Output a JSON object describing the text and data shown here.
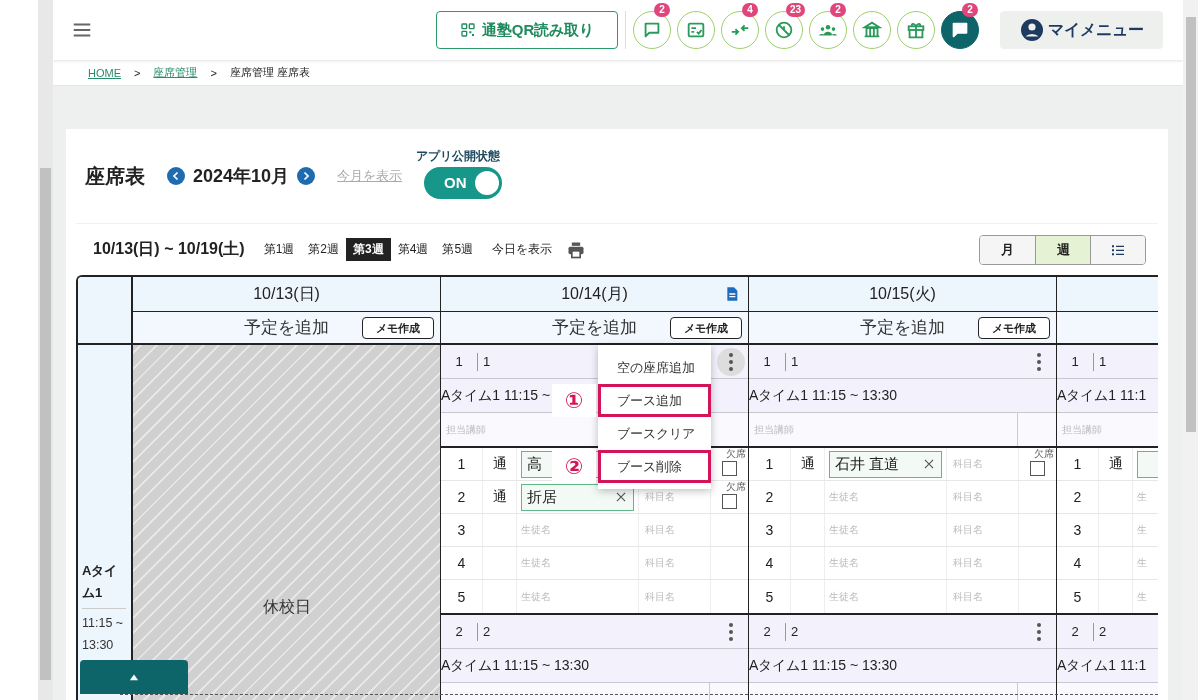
{
  "header": {
    "qr_button": "通塾QR読み取り",
    "icon_buttons": [
      {
        "kind": "chat",
        "badge": "2",
        "filled": false
      },
      {
        "kind": "checklist",
        "filled": false
      },
      {
        "kind": "arrows",
        "badge": "4",
        "filled": false
      },
      {
        "kind": "blocked",
        "badge": "23",
        "filled": false
      },
      {
        "kind": "group",
        "badge": "2",
        "filled": false
      },
      {
        "kind": "building",
        "filled": false
      },
      {
        "kind": "gift",
        "filled": false
      },
      {
        "kind": "chat",
        "badge": "2",
        "filled": true
      }
    ],
    "my_menu": "マイメニュー"
  },
  "breadcrumb": [
    {
      "kind": "link",
      "label": "HOME"
    },
    {
      "kind": "separator",
      "label": ">"
    },
    {
      "kind": "link",
      "label": "座席管理"
    },
    {
      "kind": "separator",
      "label": ">"
    },
    {
      "kind": "current",
      "label": "座席管理 座席表"
    }
  ],
  "title": "座席表",
  "month": "2024年10月",
  "this_month_link": "今月を表示",
  "publish": {
    "label": "アプリ公開状態",
    "text": "ON",
    "on": true
  },
  "week_range": "10/13(日) ~ 10/19(土)",
  "weeks": [
    {
      "label": "第1週",
      "selected": false
    },
    {
      "label": "第2週",
      "selected": false
    },
    {
      "label": "第3週",
      "selected": true
    },
    {
      "label": "第4週",
      "selected": false
    },
    {
      "label": "第5週",
      "selected": false
    }
  ],
  "today_link": "今日を表示",
  "views": [
    {
      "kind": "text",
      "label": "月",
      "selected": false
    },
    {
      "kind": "text",
      "label": "週",
      "selected": true
    },
    {
      "kind": "list",
      "selected": false
    }
  ],
  "table": {
    "time_slot": {
      "name": "Aタイム1",
      "time": "11:15 ~ 13:30"
    },
    "days": [
      {
        "date": "10/13(日)",
        "add_event": "予定を追加",
        "memo_button": "メモ作成",
        "has_memo": false,
        "holiday": "休校日"
      },
      {
        "date": "10/14(月)",
        "add_event": "予定を追加",
        "memo_button": "メモ作成",
        "has_memo": true,
        "booths": [
          {
            "number": "1",
            "name": "1",
            "menu_open": true,
            "slot": "Aタイム1 11:15 ~",
            "teacher_placeholder": "担当講師",
            "seats": [
              {
                "kind": "filled",
                "number": "1",
                "kind_label": "通",
                "student": "高",
                "absent_label": "欠席",
                "absent": false
              },
              {
                "kind": "filled",
                "number": "2",
                "kind_label": "通",
                "student": "折居",
                "clear_icon": true,
                "subject_placeholder": "科目名",
                "absent_label": "欠席",
                "absent": false
              },
              {
                "kind": "empty",
                "number": "3",
                "student_placeholder": "生徒名",
                "subject_placeholder": "科目名"
              },
              {
                "kind": "empty",
                "number": "4",
                "student_placeholder": "生徒名",
                "subject_placeholder": "科目名"
              },
              {
                "kind": "empty",
                "number": "5",
                "student_placeholder": "生徒名",
                "subject_placeholder": "科目名"
              }
            ]
          },
          {
            "number": "2",
            "name": "2",
            "menu_open": false,
            "slot": "Aタイム1 11:15 ~ 13:30"
          }
        ]
      },
      {
        "date": "10/15(火)",
        "add_event": "予定を追加",
        "memo_button": "メモ作成",
        "has_memo": false,
        "booths": [
          {
            "number": "1",
            "name": "1",
            "menu_open": false,
            "slot": "Aタイム1 11:15 ~ 13:30",
            "teacher_placeholder": "担当講師",
            "seats": [
              {
                "kind": "filled",
                "number": "1",
                "kind_label": "通",
                "student": "石井 直道",
                "clear_icon": true,
                "subject_placeholder": "科目名",
                "absent_label": "欠席",
                "absent": false
              },
              {
                "kind": "empty",
                "number": "2",
                "student_placeholder": "生徒名",
                "subject_placeholder": "科目名"
              },
              {
                "kind": "empty",
                "number": "3",
                "student_placeholder": "生徒名",
                "subject_placeholder": "科目名"
              },
              {
                "kind": "empty",
                "number": "4",
                "student_placeholder": "生徒名",
                "subject_placeholder": "科目名"
              },
              {
                "kind": "empty",
                "number": "5",
                "student_placeholder": "生徒名",
                "subject_placeholder": "科目名"
              }
            ]
          },
          {
            "number": "2",
            "name": "2",
            "menu_open": false,
            "slot": "Aタイム1 11:15 ~ 13:30"
          }
        ]
      },
      {
        "booths": [
          {
            "number": "1",
            "name": "1",
            "slot": "Aタイム1 11:1",
            "teacher_placeholder": "担当講師",
            "seats": [
              {
                "kind": "filled",
                "number": "1",
                "kind_label": "通"
              },
              {
                "kind": "empty",
                "number": "2",
                "student_placeholder": "生"
              },
              {
                "kind": "empty",
                "number": "3",
                "student_placeholder": "生"
              },
              {
                "kind": "empty",
                "number": "4",
                "student_placeholder": "生"
              },
              {
                "kind": "empty",
                "number": "5",
                "student_placeholder": "生"
              }
            ]
          },
          {
            "number": "2",
            "name": "2",
            "slot": "Aタイム1 11:1"
          }
        ]
      }
    ]
  },
  "popup": {
    "items": [
      {
        "label": "空の座席追加",
        "highlighted": false
      },
      {
        "label": "ブース追加",
        "highlighted": true,
        "callout": "①"
      },
      {
        "label": "ブースクリア",
        "highlighted": false
      },
      {
        "label": "ブース削除",
        "highlighted": true,
        "callout": "②"
      }
    ]
  }
}
